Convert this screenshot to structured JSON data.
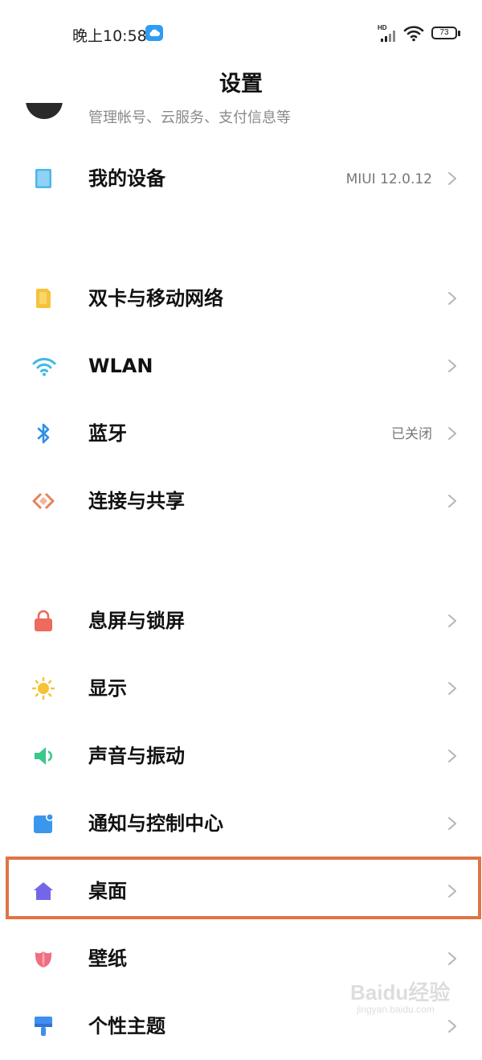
{
  "status_bar": {
    "time": "晚上10:58",
    "network": "HD",
    "battery": "73"
  },
  "header": {
    "title": "设置"
  },
  "account": {
    "subtitle": "管理帐号、云服务、支付信息等"
  },
  "items": [
    {
      "label": "我的设备",
      "value": "MIUI 12.0.12",
      "icon": "tablet-icon"
    },
    {
      "label": "双卡与移动网络",
      "value": "",
      "icon": "sim-card-icon"
    },
    {
      "label": "WLAN",
      "value": "",
      "icon": "wifi-icon"
    },
    {
      "label": "蓝牙",
      "value": "已关闭",
      "icon": "bluetooth-icon"
    },
    {
      "label": "连接与共享",
      "value": "",
      "icon": "share-icon"
    },
    {
      "label": "息屏与锁屏",
      "value": "",
      "icon": "lock-icon"
    },
    {
      "label": "显示",
      "value": "",
      "icon": "sun-icon"
    },
    {
      "label": "声音与振动",
      "value": "",
      "icon": "speaker-icon"
    },
    {
      "label": "通知与控制中心",
      "value": "",
      "icon": "notification-icon"
    },
    {
      "label": "桌面",
      "value": "",
      "icon": "home-icon"
    },
    {
      "label": "壁纸",
      "value": "",
      "icon": "tulip-icon"
    },
    {
      "label": "个性主题",
      "value": "",
      "icon": "brush-icon"
    }
  ],
  "colors": {
    "highlight": "#e07444",
    "tablet": "#4fb6ec",
    "sim": "#f5c33b",
    "wifi": "#3fb8e6",
    "bluetooth": "#2f8fe8",
    "share": "#e9805a",
    "lock": "#ec6a5e",
    "sun": "#f6c335",
    "speaker": "#39c98a",
    "notification": "#3a97ec",
    "home": "#7466e8",
    "tulip": "#f06d82",
    "brush": "#3d8ff0"
  },
  "watermark": {
    "text": "Baidu经验",
    "sub": "jingyan.baidu.com"
  }
}
